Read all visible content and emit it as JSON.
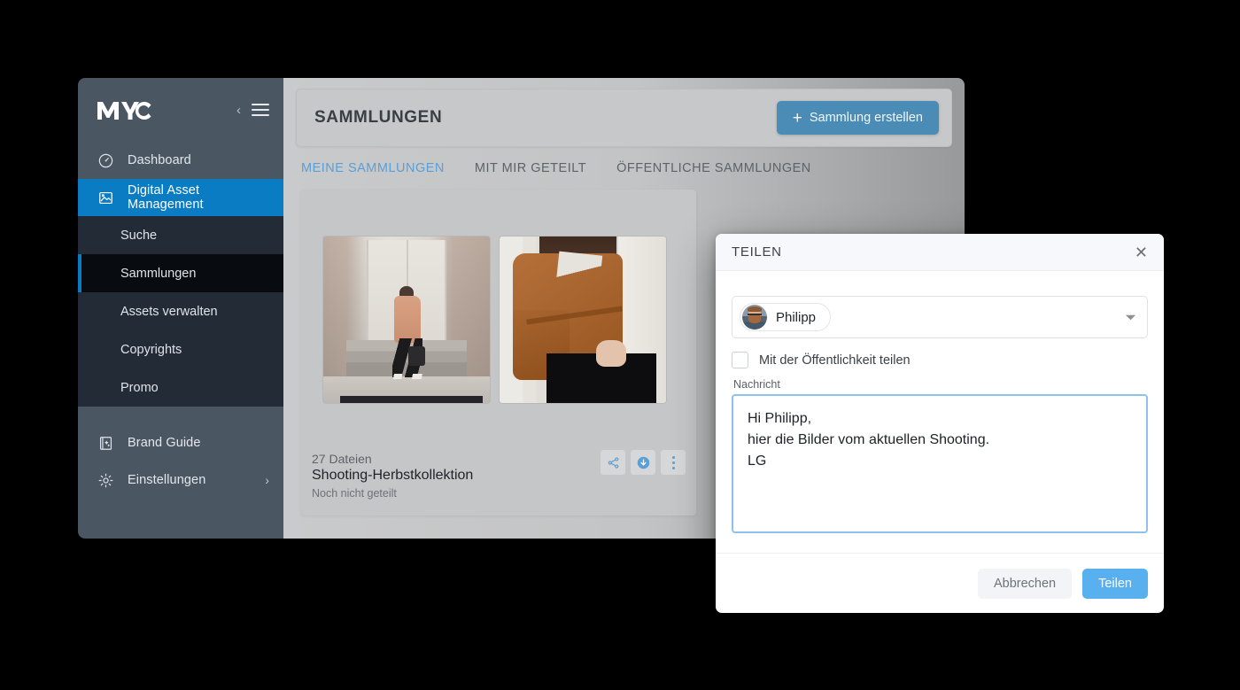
{
  "app": {
    "brand": "MMC",
    "collapse_icon": "chevron-left-icon",
    "menu_icon": "hamburger-icon"
  },
  "sidebar": {
    "items": [
      {
        "label": "Dashboard",
        "icon": "gauge-icon",
        "state": "normal"
      },
      {
        "label": "Digital Asset Management",
        "icon": "image-icon",
        "state": "active"
      },
      {
        "label": "Brand Guide",
        "icon": "brand-book-icon",
        "state": "normal"
      },
      {
        "label": "Einstellungen",
        "icon": "gear-icon",
        "state": "normal",
        "trailing": "›"
      }
    ],
    "subitems": [
      {
        "label": "Suche",
        "state": "normal"
      },
      {
        "label": "Sammlungen",
        "state": "current"
      },
      {
        "label": "Assets verwalten",
        "state": "normal"
      },
      {
        "label": "Copyrights",
        "state": "normal"
      },
      {
        "label": "Promo",
        "state": "normal"
      }
    ]
  },
  "main": {
    "page_title": "SAMMLUNGEN",
    "create_button": {
      "label": "Sammlung erstellen",
      "plus": "+"
    },
    "tabs": [
      {
        "label": "MEINE SAMMLUNGEN",
        "active": true
      },
      {
        "label": "MIT MIR GETEILT",
        "active": false
      },
      {
        "label": "ÖFFENTLICHE SAMMLUNGEN",
        "active": false
      }
    ],
    "collection": {
      "files_count": "27 Dateien",
      "name": "Shooting-Herbstkollektion",
      "status": "Noch nicht geteilt",
      "actions": [
        {
          "name": "share-icon",
          "label": "Teilen"
        },
        {
          "name": "download-icon",
          "label": "Herunterladen"
        },
        {
          "name": "more-options-icon",
          "label": "Mehr"
        }
      ],
      "thumbnails": [
        {
          "alt": "Person im Mantel vor Hauseingang"
        },
        {
          "alt": "Ockerfarbene Wickelbluse"
        }
      ]
    }
  },
  "dialog": {
    "title": "TEILEN",
    "close_icon": "close-icon",
    "recipient": {
      "name": "Philipp",
      "avatar": "user-avatar",
      "caret": "chevron-down-icon"
    },
    "public_checkbox": {
      "label": "Mit der Öffentlichkeit teilen",
      "checked": false
    },
    "message": {
      "label": "Nachricht",
      "value": "Hi Philipp,\nhier die Bilder vom aktuellen Shooting.\nLG",
      "placeholder": ""
    },
    "cancel_button": "Abbrechen",
    "share_button": "Teilen"
  },
  "colors": {
    "accent_blue": "#0a7cc3",
    "sidebar_bg": "#4b5663",
    "sidebar_sub_bg": "#222b36",
    "sidebar_current_bg": "#080c11",
    "button_blue": "#4a8cb5",
    "dialog_blue": "#58b0ef",
    "tab_active": "#5b9fd4",
    "backdrop": "#000000"
  }
}
